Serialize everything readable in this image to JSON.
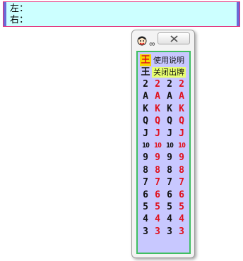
{
  "topbar": {
    "left_label": "左：",
    "right_label": "右："
  },
  "window": {
    "title": "ᢁ",
    "close_glyph": "✕"
  },
  "panel": {
    "big_joker": "王",
    "small_joker": "王",
    "menu": [
      "使用说明",
      "关闭出牌"
    ],
    "rows": [
      {
        "rank": "2",
        "cols": [
          "2",
          "2",
          "2",
          "2"
        ]
      },
      {
        "rank": "A",
        "cols": [
          "A",
          "A",
          "A",
          "A"
        ]
      },
      {
        "rank": "K",
        "cols": [
          "K",
          "K",
          "K",
          "K"
        ]
      },
      {
        "rank": "Q",
        "cols": [
          "Q",
          "Q",
          "Q",
          "Q"
        ]
      },
      {
        "rank": "J",
        "cols": [
          "J",
          "J",
          "J",
          "J"
        ]
      },
      {
        "rank": "10",
        "cols": [
          "10",
          "10",
          "10",
          "10"
        ]
      },
      {
        "rank": "9",
        "cols": [
          "9",
          "9",
          "9",
          "9"
        ]
      },
      {
        "rank": "8",
        "cols": [
          "8",
          "8",
          "8",
          "8"
        ]
      },
      {
        "rank": "7",
        "cols": [
          "7",
          "7",
          "7",
          "7"
        ]
      },
      {
        "rank": "6",
        "cols": [
          "6",
          "6",
          "6",
          "6"
        ]
      },
      {
        "rank": "5",
        "cols": [
          "5",
          "5",
          "5",
          "5"
        ]
      },
      {
        "rank": "4",
        "cols": [
          "4",
          "4",
          "4",
          "4"
        ]
      },
      {
        "rank": "3",
        "cols": [
          "3",
          "3",
          "3",
          "3"
        ]
      }
    ]
  },
  "colors": {
    "suit_colors": [
      "black",
      "red",
      "black",
      "red"
    ],
    "panel_bg": "#c8c8ff",
    "panel_border": "#3fbf62",
    "topbar_bg": "#ccffff"
  },
  "icons": {
    "app": "joker-face-icon",
    "close": "close-icon"
  }
}
